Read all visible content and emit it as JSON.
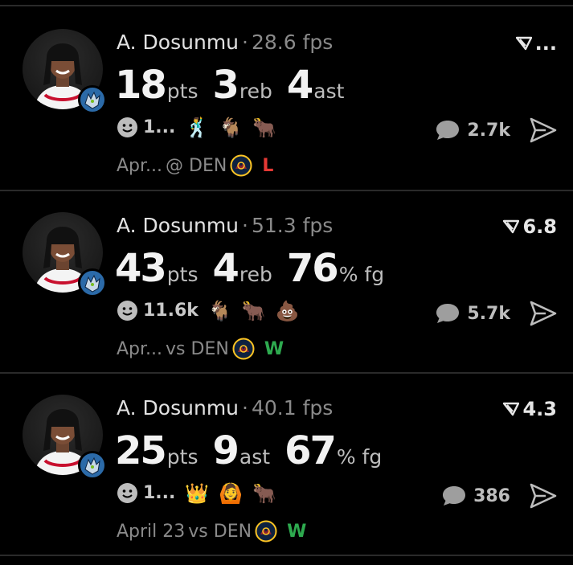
{
  "posts": [
    {
      "player": "A. Dosunmu",
      "separator": "·",
      "fps": "28.6 fps",
      "rating": "...",
      "stats": [
        {
          "value": "18",
          "unit": "pts"
        },
        {
          "value": "3",
          "unit": "reb"
        },
        {
          "value": "4",
          "unit": "ast"
        }
      ],
      "reaction_count": "1...",
      "emojis": [
        "🕺",
        "🐐",
        "🐂"
      ],
      "comments": "2.7k",
      "date": "Apr...",
      "matchup": "@ DEN",
      "result": "L",
      "result_color": "#e53935"
    },
    {
      "player": "A. Dosunmu",
      "separator": "·",
      "fps": "51.3 fps",
      "rating": "6.8",
      "stats": [
        {
          "value": "43",
          "unit": "pts"
        },
        {
          "value": "4",
          "unit": "reb"
        },
        {
          "value": "76",
          "unit": "% fg"
        }
      ],
      "reaction_count": "11.6k",
      "emojis": [
        "🐐",
        "🐂",
        "💩"
      ],
      "comments": "5.7k",
      "date": "Apr...",
      "matchup": "vs DEN",
      "result": "W",
      "result_color": "#2eaa4f"
    },
    {
      "player": "A. Dosunmu",
      "separator": "·",
      "fps": "40.1 fps",
      "rating": "4.3",
      "stats": [
        {
          "value": "25",
          "unit": "pts"
        },
        {
          "value": "9",
          "unit": "ast"
        },
        {
          "value": "67",
          "unit": "% fg"
        }
      ],
      "reaction_count": "1...",
      "emojis": [
        "👑",
        "🙆",
        "🐂"
      ],
      "comments": "386",
      "date": "April 23",
      "matchup": "vs DEN",
      "result": "W",
      "result_color": "#2eaa4f"
    }
  ],
  "icons": {
    "rating": "rating-arrow-icon",
    "reaction": "smiley-icon",
    "comment": "comment-bubble-icon",
    "share": "share-arrow-icon",
    "opponent": "nuggets-logo-icon",
    "team": "timberwolves-logo-icon"
  },
  "colors": {
    "background": "#000000",
    "divider": "#2a2a2a",
    "muted": "#8a8a8a",
    "win": "#2eaa4f",
    "loss": "#e53935"
  }
}
